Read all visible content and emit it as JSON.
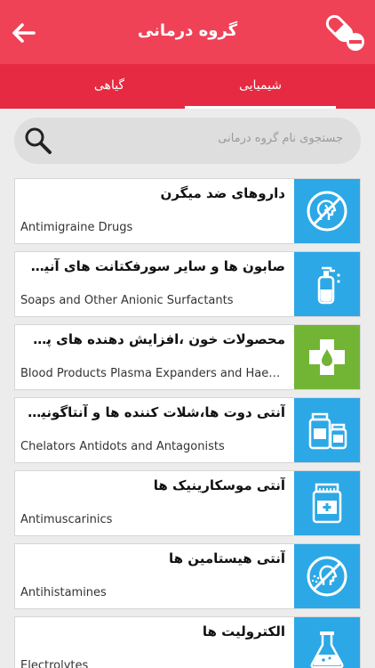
{
  "header": {
    "title": "گروه درمانی",
    "back_icon": "arrow-left-icon",
    "logo_icon": "pill-capsule-icon"
  },
  "tabs": [
    {
      "label": "گیاهی",
      "active": false
    },
    {
      "label": "شیمیایی",
      "active": true
    }
  ],
  "search": {
    "placeholder": "جستجوی نام گروه درمانی",
    "icon": "search-icon"
  },
  "items": [
    {
      "fa": "داروهای ضد میگرن",
      "en": "Antimigraine Drugs",
      "icon": "no-headache-icon",
      "color": "#2ca8e7"
    },
    {
      "fa": "صابون ها و سایر سورفکتانت های آنیونی",
      "en": "Soaps and Other Anionic Surfactants",
      "icon": "soap-bottle-icon",
      "color": "#2ca8e7"
    },
    {
      "fa": "محصولات خون ،افزایش دهنده های پلاسم…",
      "en": "Blood Products Plasma Expanders and Hae…",
      "icon": "medical-cross-icon",
      "color": "#72b535"
    },
    {
      "fa": "آنتی دوت ها،شلات کننده ها و آنتاگونیست ها",
      "en": "Chelators Antidots and  Antagonists",
      "icon": "medicine-jars-icon",
      "color": "#2ca8e7"
    },
    {
      "fa": "آنتی موسکارینیک ها",
      "en": "Antimuscarinics",
      "icon": "medicine-bottle-icon",
      "color": "#2ca8e7"
    },
    {
      "fa": "آنتی هیستامین ها",
      "en": "Antihistamines",
      "icon": "no-sneeze-icon",
      "color": "#2ca8e7"
    },
    {
      "fa": "الکترولیت ها",
      "en": "Electrolytes",
      "icon": "flask-icon",
      "color": "#2ca8e7"
    }
  ],
  "colors": {
    "appbar": "#ef4257",
    "tabbar": "#e52a41",
    "icon_blue": "#2ca8e7",
    "icon_green": "#72b535"
  }
}
